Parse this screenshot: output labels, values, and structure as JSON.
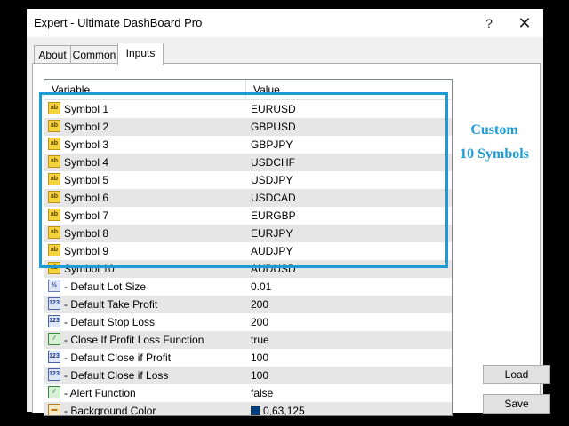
{
  "window": {
    "title": "Expert - Ultimate DashBoard Pro",
    "help_glyph": "?",
    "close_glyph": "✕"
  },
  "tabs": [
    {
      "label": "About",
      "active": false
    },
    {
      "label": "Common",
      "active": false
    },
    {
      "label": "Inputs",
      "active": true
    }
  ],
  "grid": {
    "columns": [
      "Variable",
      "Value"
    ],
    "rows": [
      {
        "icon": "ab-string-icon",
        "glyph": "ab",
        "variable": "Symbol 1",
        "value": "EURUSD"
      },
      {
        "icon": "ab-string-icon",
        "glyph": "ab",
        "variable": "Symbol 2",
        "value": "GBPUSD"
      },
      {
        "icon": "ab-string-icon",
        "glyph": "ab",
        "variable": "Symbol 3",
        "value": "GBPJPY"
      },
      {
        "icon": "ab-string-icon",
        "glyph": "ab",
        "variable": "Symbol 4",
        "value": "USDCHF"
      },
      {
        "icon": "ab-string-icon",
        "glyph": "ab",
        "variable": "Symbol 5",
        "value": "USDJPY"
      },
      {
        "icon": "ab-string-icon",
        "glyph": "ab",
        "variable": "Symbol 6",
        "value": "USDCAD"
      },
      {
        "icon": "ab-string-icon",
        "glyph": "ab",
        "variable": "Symbol 7",
        "value": "EURGBP"
      },
      {
        "icon": "ab-string-icon",
        "glyph": "ab",
        "variable": "Symbol 8",
        "value": "EURJPY"
      },
      {
        "icon": "ab-string-icon",
        "glyph": "ab",
        "variable": "Symbol 9",
        "value": "AUDJPY"
      },
      {
        "icon": "ab-string-icon",
        "glyph": "ab",
        "variable": "Symbol 10",
        "value": "AUDUSD"
      },
      {
        "icon": "fraction-icon",
        "glyph": "½",
        "variable": "- Default Lot Size",
        "value": "0.01"
      },
      {
        "icon": "integer-icon",
        "glyph": "123",
        "variable": "- Default Take Profit",
        "value": "200"
      },
      {
        "icon": "integer-icon",
        "glyph": "123",
        "variable": "- Default Stop Loss",
        "value": "200"
      },
      {
        "icon": "bool-icon",
        "glyph": "⁄",
        "variable": "- Close If Profit Loss Function",
        "value": "true"
      },
      {
        "icon": "integer-icon",
        "glyph": "123",
        "variable": "- Default Close if Profit",
        "value": "100"
      },
      {
        "icon": "integer-icon",
        "glyph": "123",
        "variable": "- Default Close if Loss",
        "value": "100"
      },
      {
        "icon": "bool-icon",
        "glyph": "⁄",
        "variable": "- Alert Function",
        "value": "false"
      },
      {
        "icon": "color-icon",
        "glyph": "▬",
        "variable": "- Background Color",
        "value": "0,63,125",
        "swatch": "#003f7d"
      }
    ]
  },
  "annotation": {
    "line1": "Custom",
    "line2": "10 Symbols",
    "color": "#1e9ad6"
  },
  "buttons": {
    "load": "Load",
    "save": "Save"
  }
}
